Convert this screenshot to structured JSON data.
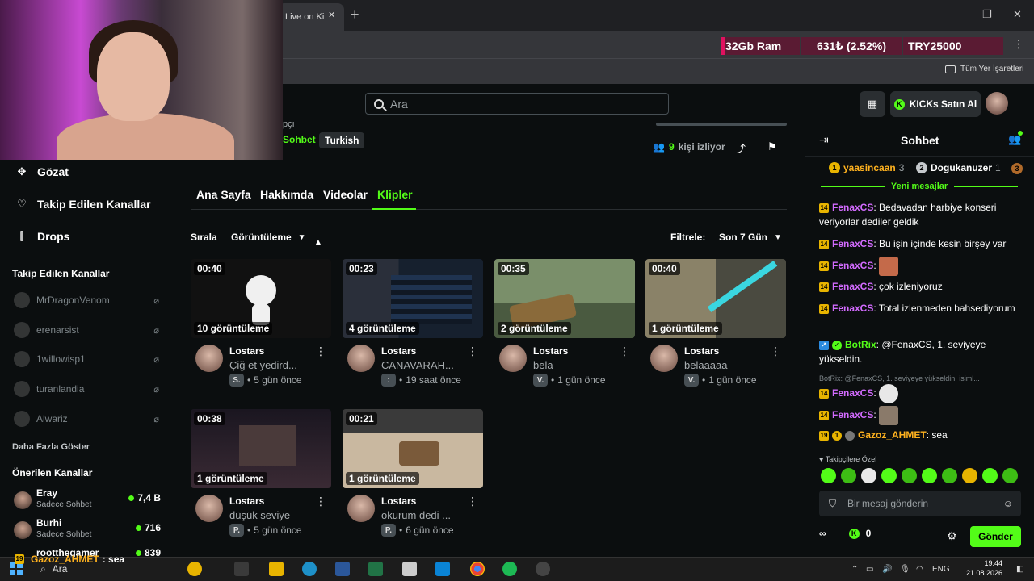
{
  "browser": {
    "tab_title": "Live on Ki",
    "extensions": {
      "ram": "32Gb Ram",
      "pct": "631₺ (2.52%)",
      "try": "TRY25000"
    },
    "bookmarks_all": "Tüm Yer İşaretleri"
  },
  "header": {
    "search_placeholder": "Ara",
    "kicks_button": "KICKs Satın Al"
  },
  "channel": {
    "partial_category": "pçı",
    "category_tag": "Sohbet",
    "language_tag": "Turkish",
    "viewers_count": "9",
    "viewers_label": "kişi izliyor"
  },
  "sidebar": {
    "nav": [
      {
        "label": "Gözat",
        "icon": "compass-icon"
      },
      {
        "label": "Takip Edilen Kanallar",
        "icon": "heart-icon"
      },
      {
        "label": "Drops",
        "icon": "drops-icon"
      }
    ],
    "following_heading": "Takip Edilen Kanallar",
    "following": [
      "MrDragonVenom",
      "erenarsist",
      "1willowisp1",
      "turanlandia",
      "Alwariz"
    ],
    "show_more": "Daha Fazla Göster",
    "recommended_heading": "Önerilen Kanallar",
    "recommended": [
      {
        "name": "Eray",
        "sub": "Sadece Sohbet",
        "count": "7,4 B"
      },
      {
        "name": "Burhi",
        "sub": "Sadece Sohbet",
        "count": "716"
      },
      {
        "name": "rootthegamer",
        "sub": "",
        "count": "839"
      }
    ]
  },
  "tabs": [
    "Ana Sayfa",
    "Hakkımda",
    "Videolar",
    "Klipler"
  ],
  "sort": {
    "label": "Sırala",
    "value": "Görüntüleme"
  },
  "filter": {
    "label": "Filtrele:",
    "value": "Son 7 Gün"
  },
  "clips": [
    {
      "duration": "00:40",
      "views": "10 görüntüleme",
      "author": "Lostars",
      "title": "Çiğ et yedird...",
      "badge": "S.",
      "time": "5 gün önce",
      "color": "#111111"
    },
    {
      "duration": "00:23",
      "views": "4 görüntüleme",
      "author": "Lostars",
      "title": "CANAVARAH...",
      "badge": ":",
      "time": "19 saat önce",
      "color": "#1b2230"
    },
    {
      "duration": "00:35",
      "views": "2 görüntüleme",
      "author": "Lostars",
      "title": "bela",
      "badge": "V.",
      "time": "1 gün önce",
      "color": "#5d7a4a"
    },
    {
      "duration": "00:40",
      "views": "1 görüntüleme",
      "author": "Lostars",
      "title": "belaaaaa",
      "badge": "V.",
      "time": "1 gün önce",
      "color": "#6a6a58"
    },
    {
      "duration": "00:38",
      "views": "1 görüntüleme",
      "author": "Lostars",
      "title": "düşük seviye",
      "badge": "P.",
      "time": "5 gün önce",
      "color": "#2a2230"
    },
    {
      "duration": "00:21",
      "views": "1 görüntüleme",
      "author": "Lostars",
      "title": "okurum dedi ...",
      "badge": "P.",
      "time": "6 gün önce",
      "color": "#5a4a3a"
    }
  ],
  "chat": {
    "title": "Sohbet",
    "leaders": [
      {
        "name": "yaasincaan",
        "count": "3"
      },
      {
        "name": "Dogukanuzer",
        "count": "1"
      }
    ],
    "new_messages": "Yeni mesajlar",
    "messages": [
      {
        "user": "FenaxCS",
        "text": "Bedavadan harbiye konseri veriyorlar dediler geldik"
      },
      {
        "user": "FenaxCS",
        "text": "Bu işin içinde kesin birşey var"
      },
      {
        "user": "FenaxCS",
        "text": ""
      },
      {
        "user": "FenaxCS",
        "text": "çok izleniyoruz"
      },
      {
        "user": "FenaxCS",
        "text": "Total izlenmeden bahsediyorum"
      },
      {
        "user": "BotRix",
        "text": "@FenaxCS, 1. seviyeye yükseldin."
      },
      {
        "user": "FenaxCS",
        "text": ""
      },
      {
        "user": "FenaxCS",
        "text": ""
      },
      {
        "user": "Gazoz_AHMET",
        "text": "sea"
      }
    ],
    "reply_preview": "BotRix: @FenaxCS, 1. seviyeye yükseldin. isiml...",
    "followers_only": "Takipçilere Özel",
    "input_placeholder": "Bir mesaj gönderin",
    "kicks_count": "0",
    "send_label": "Gönder"
  },
  "overlay": {
    "user": "Gazoz_AHMET",
    "text": ": sea"
  },
  "taskbar": {
    "search": "Ara",
    "lang": "ENG",
    "time": "19:44",
    "date": "21.08.2026"
  }
}
